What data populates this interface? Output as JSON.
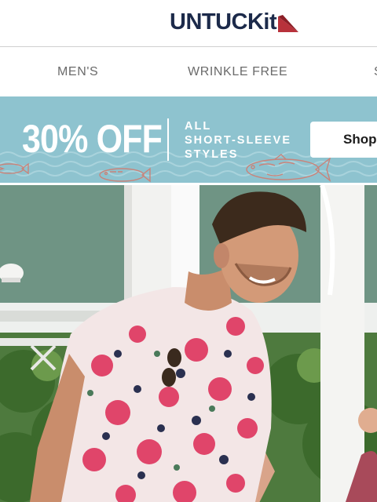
{
  "brand": {
    "name": "UNTUCKit"
  },
  "nav": {
    "items": [
      {
        "label": "MEN'S"
      },
      {
        "label": "WRINKLE FREE"
      },
      {
        "label": "S"
      }
    ]
  },
  "promo": {
    "headline": "30% OFF",
    "subline": [
      "ALL",
      "SHORT-SLEEVE",
      "STYLES"
    ],
    "button_label": "Shop",
    "colors": {
      "background": "#8ec3cf",
      "text": "#ffffff",
      "fish": "#c9837a"
    }
  },
  "hero": {
    "image_icon": "hero-photo-man-floral-shirt"
  },
  "colors": {
    "brand_navy": "#1c2a4a",
    "brand_red": "#b8323b"
  }
}
